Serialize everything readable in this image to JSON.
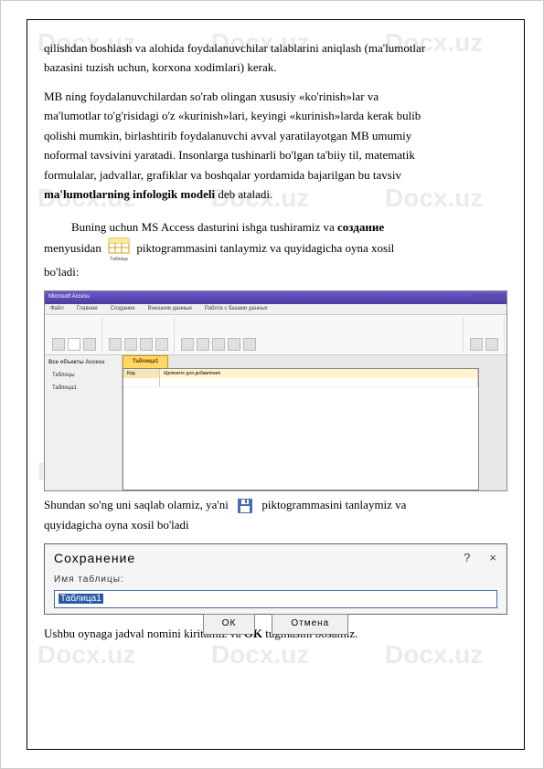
{
  "watermark": "Docx.uz",
  "paragraphs": {
    "p1_l1": "qilishdan boshlash va alohida foydalanuvchilar talablarini aniqlash (ma'lumotlar",
    "p1_l2": "bazasini tuzish uchun, korxona xodimlari) kerak.",
    "p2_l1": "MB ning foydalanuvchilardan so'rab olingan xususiy «ko'rinish»lar va",
    "p2_l2": "ma'lumotlar to'g'risidagi o'z «kurinish»lari, keyingi «kurinish»larda kerak bulib",
    "p2_l3": "qolishi mumkin, birlashtirib foydalanuvchi avval yaratilayotgan MB umumiy",
    "p2_l4": "noformal tavsivini yaratadi. Insonlarga tushinarli bo'lgan ta'biiy til, matematik",
    "p2_l5": "formulalar, jadvallar, grafiklar va boshqalar yordamida bajarilgan bu tavsiv",
    "p2_bold": "ma'lumotlarning infologik modeli",
    "p2_end": " deb ataladi.",
    "p3_pre": "Buning uchun MS Access dasturini ishga tushiramiz va ",
    "p3_bold": "создание",
    "p3_l2a": "menyusidan ",
    "p3_l2b": " piktogrammasini tanlaymiz va quyidagicha oyna xosil",
    "p3_l3": "bo'ladi:",
    "p4_l1a": "Shundan so'ng uni saqlab olamiz, ya'ni ",
    "p4_l1b": " piktogrammasini tanlaymiz va",
    "p4_l2": "quyidagicha oyna xosil bo'ladi",
    "p5_a": "Ushbu oynaga jadval nomini kiritamiz va ",
    "p5_bold": "OK",
    "p5_b": " tugmasini bosamiz."
  },
  "tableIconLabel": "Таблица",
  "screenshot1": {
    "title": "Microsoft Access",
    "menu": [
      "Файл",
      "Главная",
      "Создание",
      "Внешние данные",
      "Работа с базами данных"
    ],
    "sidebarHeader": "Все объекты Access",
    "sidebarItems": [
      "Таблицы",
      "Таблица1"
    ],
    "tabName": "Таблица1",
    "col1": "Код",
    "col2": "Щелкните для добавления"
  },
  "dialog": {
    "title": "Сохранение",
    "label": "Имя таблицы:",
    "value": "Таблица1",
    "ok": "ОК",
    "cancel": "Отмена"
  }
}
